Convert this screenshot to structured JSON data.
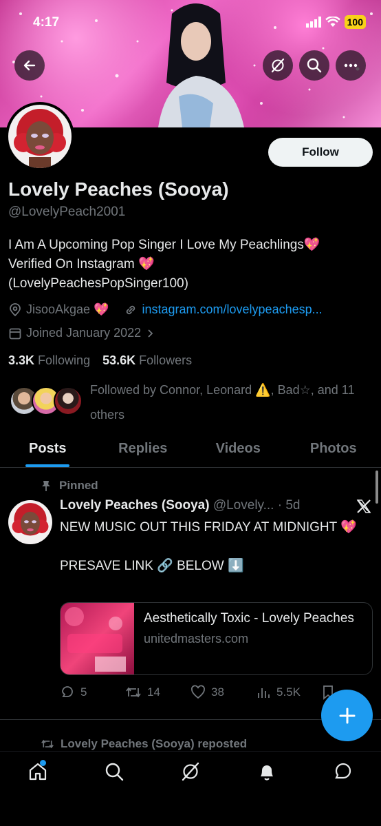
{
  "status_bar": {
    "time": "4:17",
    "battery": "100"
  },
  "profile": {
    "follow_label": "Follow",
    "name": "Lovely Peaches (Sooya)",
    "handle": "@LovelyPeach2001",
    "bio_line1": "I Am A Upcoming Pop Singer I Love My Peachlings💖",
    "bio_line2": "Verified On Instagram 💖",
    "bio_line3": "(LovelyPeachesPopSinger100)",
    "location": "JisooAkgae 💖",
    "website": "instagram.com/lovelypeachesp...",
    "joined": "Joined January 2022",
    "following_count": "3.3K",
    "following_label": "Following",
    "followers_count": "53.6K",
    "followers_label": "Followers",
    "followed_by": "Followed by Connor, Leonard ⚠️, Bad☆, and 11 others"
  },
  "tabs": [
    {
      "label": "Posts"
    },
    {
      "label": "Replies"
    },
    {
      "label": "Videos"
    },
    {
      "label": "Photos"
    }
  ],
  "post": {
    "pinned_label": "Pinned",
    "author": "Lovely Peaches (Sooya)",
    "handle_time": "@Lovely... · 5d",
    "text_line1": "NEW MUSIC OUT THIS FRIDAY AT MIDNIGHT 💖",
    "text_line2": "PRESAVE LINK 🔗 BELOW ⬇️",
    "card_title": "Aesthetically Toxic - Lovely Peaches",
    "card_domain": "unitedmasters.com",
    "replies": "5",
    "reposts": "14",
    "likes": "38",
    "views": "5.5K"
  },
  "next_item": {
    "repost_label": "Lovely Peaches (Sooya) reposted"
  },
  "colors": {
    "accent": "#1d9bf0",
    "background": "#000000",
    "muted": "#71767b"
  }
}
